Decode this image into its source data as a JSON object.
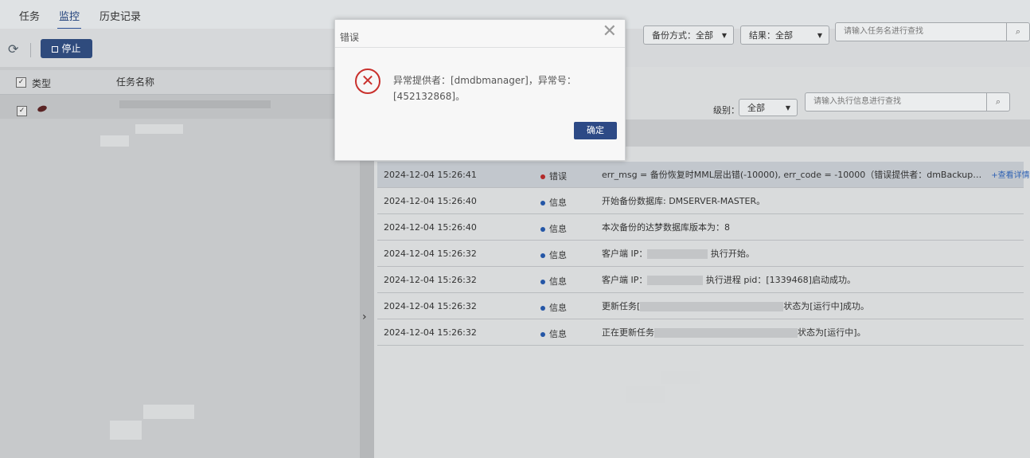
{
  "tabs": [
    {
      "label": "任务"
    },
    {
      "label": "监控"
    },
    {
      "label": "历史记录"
    }
  ],
  "toolbar": {
    "stop_label": "停止",
    "backup_mode": "备份方式：全部",
    "result": "结果：全部",
    "task_search_placeholder": "请输入任务名进行查找"
  },
  "task_grid": {
    "col_type": "类型",
    "col_name": "任务名称"
  },
  "log_filter": {
    "level_label": "级别：",
    "level_value": "全部",
    "search_placeholder": "请输入执行信息进行查找"
  },
  "logs": [
    {
      "time": "2024-12-04 15:26:41",
      "level": "错误",
      "msg": "err_msg = 备份恢复时MML层出错(-10000), err_code = -10000（错误提供者：dmBackup…",
      "link": "+查看详情"
    },
    {
      "time": "2024-12-04 15:26:40",
      "level": "信息",
      "msg": "开始备份数据库: DMSERVER-MASTER。"
    },
    {
      "time": "2024-12-04 15:26:40",
      "level": "信息",
      "msg": "本次备份的达梦数据库版本为：8"
    },
    {
      "time": "2024-12-04 15:26:32",
      "level": "信息",
      "msg_a": "客户端 IP：",
      "msg_b": "执行开始。"
    },
    {
      "time": "2024-12-04 15:26:32",
      "level": "信息",
      "msg_a": "客户端 IP：",
      "msg_b": "执行进程 pid：[1339468]启动成功。"
    },
    {
      "time": "2024-12-04 15:26:32",
      "level": "信息",
      "msg_a": "更新任务[",
      "msg_b": "状态为[运行中]成功。"
    },
    {
      "time": "2024-12-04 15:26:32",
      "level": "信息",
      "msg_a": "正在更新任务",
      "msg_b": "状态为[运行中]。"
    }
  ],
  "dialog": {
    "title": "错误",
    "message": "异常提供者：[dmdbmanager]，异常号：[452132868]。",
    "ok_label": "确定"
  },
  "colors": {
    "primary": "#2d4a86",
    "error": "#c9302c",
    "info": "#2456a6"
  }
}
